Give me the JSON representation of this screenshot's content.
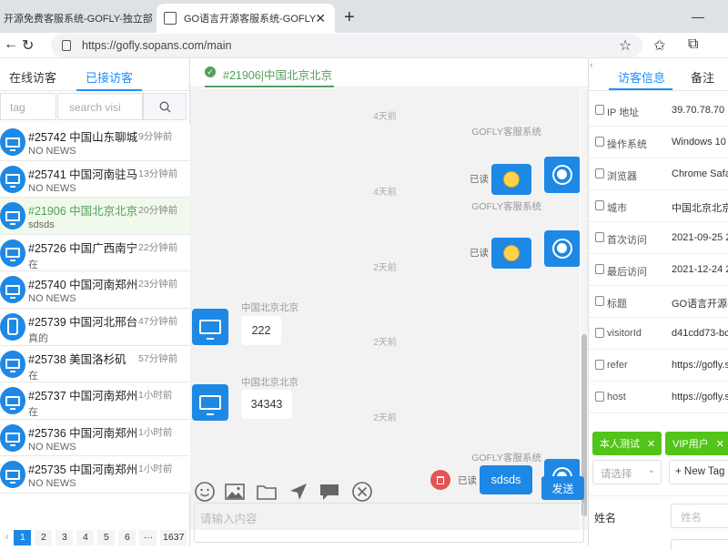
{
  "browser": {
    "tabs": [
      {
        "title": "开源免费客服系统-GOFLY-独立部",
        "active": false
      },
      {
        "title": "GO语言开源客服系统-GOFLY",
        "active": true
      }
    ],
    "url": "https://gofly.sopans.com/main"
  },
  "left_panel": {
    "tabs": [
      {
        "label": "在线访客",
        "active": false
      },
      {
        "label": "已接访客",
        "active": true
      }
    ],
    "filter": {
      "tag_placeholder": "tag",
      "search_placeholder": "search visi"
    },
    "visitors": [
      {
        "name": "#25742 中国山东聊城",
        "time": "9分钟前",
        "last_msg": "NO NEWS",
        "device": "pc",
        "selected": false
      },
      {
        "name": "#25741 中国河南驻马",
        "time": "13分钟前",
        "last_msg": "NO NEWS",
        "device": "pc",
        "selected": false
      },
      {
        "name": "#21906 中国北京北京",
        "time": "20分钟前",
        "last_msg": "sdsds",
        "device": "pc",
        "selected": true
      },
      {
        "name": "#25726 中国广西南宁",
        "time": "22分钟前",
        "last_msg": "在",
        "device": "pc",
        "selected": false
      },
      {
        "name": "#25740 中国河南郑州",
        "time": "23分钟前",
        "last_msg": "NO NEWS",
        "device": "pc",
        "selected": false
      },
      {
        "name": "#25739 中国河北邢台",
        "time": "47分钟前",
        "last_msg": "真的",
        "device": "mobile",
        "selected": false
      },
      {
        "name": "#25738 美国洛杉矶",
        "time": "57分钟前",
        "last_msg": "在",
        "device": "pc",
        "selected": false
      },
      {
        "name": "#25737 中国河南郑州",
        "time": "1小时前",
        "last_msg": "在",
        "device": "pc",
        "selected": false
      },
      {
        "name": "#25736 中国河南郑州",
        "time": "1小时前",
        "last_msg": "NO NEWS",
        "device": "pc",
        "selected": false
      },
      {
        "name": "#25735 中国河南郑州",
        "time": "1小时前",
        "last_msg": "NO NEWS",
        "device": "pc",
        "selected": false
      }
    ],
    "pagination": {
      "prev": "‹",
      "pages": [
        "1",
        "2",
        "3",
        "4",
        "5",
        "6",
        "···",
        "1637"
      ],
      "current": "1"
    }
  },
  "chat": {
    "title": "#21906|中国北京北京",
    "messages": [
      {
        "kind": "agent",
        "timestamp": "4天前",
        "sender": "GOFLY客服系统",
        "status": "已读",
        "content": "emoji-1"
      },
      {
        "kind": "agent",
        "timestamp": "4天前",
        "sender": "GOFLY客服系统",
        "status": "已读",
        "content": "emoji-2"
      },
      {
        "kind": "visitor",
        "timestamp": "2天前",
        "sender": "中国北京北京",
        "content": "222"
      },
      {
        "kind": "visitor",
        "timestamp": "2天前",
        "sender": "中国北京北京",
        "content": "34343"
      },
      {
        "kind": "agent",
        "timestamp": "2天前",
        "sender": "GOFLY客服系统",
        "status": "已读",
        "content": "sdsds"
      }
    ],
    "send_label": "发送",
    "input_placeholder": "请输入内容"
  },
  "right_panel": {
    "tabs": [
      {
        "label": "访客信息",
        "active": true
      },
      {
        "label": "备注",
        "active": false
      }
    ],
    "info": [
      {
        "label": "IP 地址",
        "value": "39.70.78.70"
      },
      {
        "label": "操作系统",
        "value": "Windows 10"
      },
      {
        "label": "浏览器",
        "value": "Chrome Safari"
      },
      {
        "label": "城市",
        "value": "中国北京北京"
      },
      {
        "label": "首次访问",
        "value": "2021-09-25 2"
      },
      {
        "label": "最后访问",
        "value": "2021-12-24 2"
      },
      {
        "label": "标题",
        "value": "GO语言开源客服"
      },
      {
        "label": "visitorId",
        "value": "d41cdd73-bc"
      },
      {
        "label": "refer",
        "value": "https://gofly.s"
      },
      {
        "label": "host",
        "value": "https://gofly.s"
      }
    ],
    "tags": [
      "本人测试",
      "VIP用户"
    ],
    "tag_select_placeholder": "请选择",
    "new_tag_label": "+ New Tag",
    "name_label": "姓名",
    "name_placeholder": "姓名",
    "colors": {
      "primary": "#1e88e5",
      "success": "#52c41a",
      "danger": "#e55353"
    }
  }
}
